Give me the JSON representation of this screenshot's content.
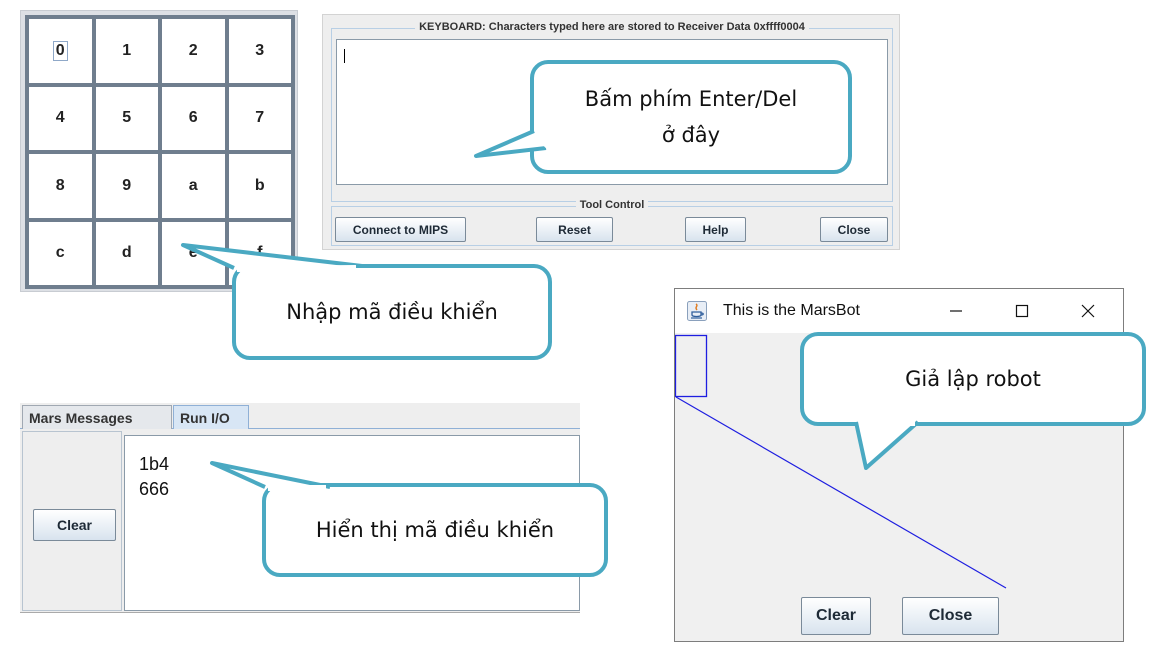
{
  "keypad": {
    "keys": [
      "0",
      "1",
      "2",
      "3",
      "4",
      "5",
      "6",
      "7",
      "8",
      "9",
      "a",
      "b",
      "c",
      "d",
      "e",
      "f"
    ]
  },
  "keyboard": {
    "legend": "KEYBOARD: Characters typed here are stored to Receiver Data 0xffff0004",
    "text": ""
  },
  "tool_control": {
    "legend": "Tool Control",
    "connect_label": "Connect to MIPS",
    "reset_label": "Reset",
    "help_label": "Help",
    "close_label": "Close"
  },
  "messages": {
    "tabs": [
      "Mars Messages",
      "Run I/O"
    ],
    "active_tab": "Run I/O",
    "clear_label": "Clear",
    "lines": [
      "1b4",
      "666"
    ]
  },
  "marsbot": {
    "title": "This is the MarsBot",
    "clear_label": "Clear",
    "close_label": "Close",
    "path_color": "#1e1ee0"
  },
  "callouts": {
    "keyboard_hint_line1": "Bấm phím Enter/Del",
    "keyboard_hint_line2": "ở đây",
    "keypad_hint": "Nhập mã điều khiển",
    "display_hint": "Hiển thị mã điều khiển",
    "robot_hint": "Giả lập robot",
    "border_color": "#4aa9c2"
  }
}
